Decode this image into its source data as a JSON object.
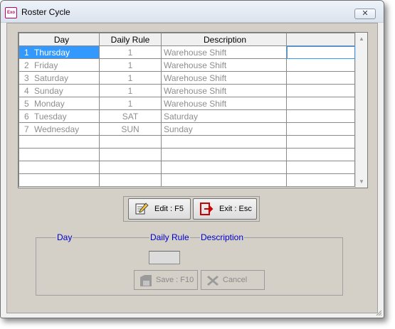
{
  "window": {
    "title": "Roster Cycle",
    "app_icon_text": "Exo",
    "close_glyph": "✕"
  },
  "grid": {
    "columns": [
      "Day",
      "Daily Rule",
      "Description",
      ""
    ],
    "rows": [
      {
        "num": "1",
        "day": "Thursday",
        "rule": "1",
        "desc": "Warehouse Shift",
        "extra": ""
      },
      {
        "num": "2",
        "day": "Friday",
        "rule": "1",
        "desc": "Warehouse Shift",
        "extra": ""
      },
      {
        "num": "3",
        "day": "Saturday",
        "rule": "1",
        "desc": "Warehouse Shift",
        "extra": ""
      },
      {
        "num": "4",
        "day": "Sunday",
        "rule": "1",
        "desc": "Warehouse Shift",
        "extra": ""
      },
      {
        "num": "5",
        "day": "Monday",
        "rule": "1",
        "desc": "Warehouse Shift",
        "extra": ""
      },
      {
        "num": "6",
        "day": "Tuesday",
        "rule": "SAT",
        "desc": "Saturday",
        "extra": ""
      },
      {
        "num": "7",
        "day": "Wednesday",
        "rule": "SUN",
        "desc": "Sunday",
        "extra": ""
      },
      {
        "num": "",
        "day": "",
        "rule": "",
        "desc": "",
        "extra": ""
      },
      {
        "num": "",
        "day": "",
        "rule": "",
        "desc": "",
        "extra": ""
      },
      {
        "num": "",
        "day": "",
        "rule": "",
        "desc": "",
        "extra": ""
      },
      {
        "num": "",
        "day": "",
        "rule": "",
        "desc": "",
        "extra": ""
      }
    ],
    "selected_row": 0,
    "scroll_up_glyph": "▲",
    "scroll_down_glyph": "▼"
  },
  "toolbar": {
    "edit_label": "Edit : F5",
    "exit_label": "Exit : Esc"
  },
  "editor": {
    "day_label": "Day",
    "rule_label": "Daily Rule",
    "desc_label": "Description",
    "rule_value": "",
    "save_label": "Save : F10",
    "cancel_label": "Cancel"
  },
  "colors": {
    "selection": "#3399ff",
    "group_label": "#0000cc",
    "exit_icon": "#cc0000",
    "client_bg": "#d4d0c8"
  },
  "icons": {
    "edit": "notepad-pencil-icon",
    "exit": "exit-door-icon",
    "save": "save-disk-icon",
    "cancel": "cancel-x-icon"
  }
}
